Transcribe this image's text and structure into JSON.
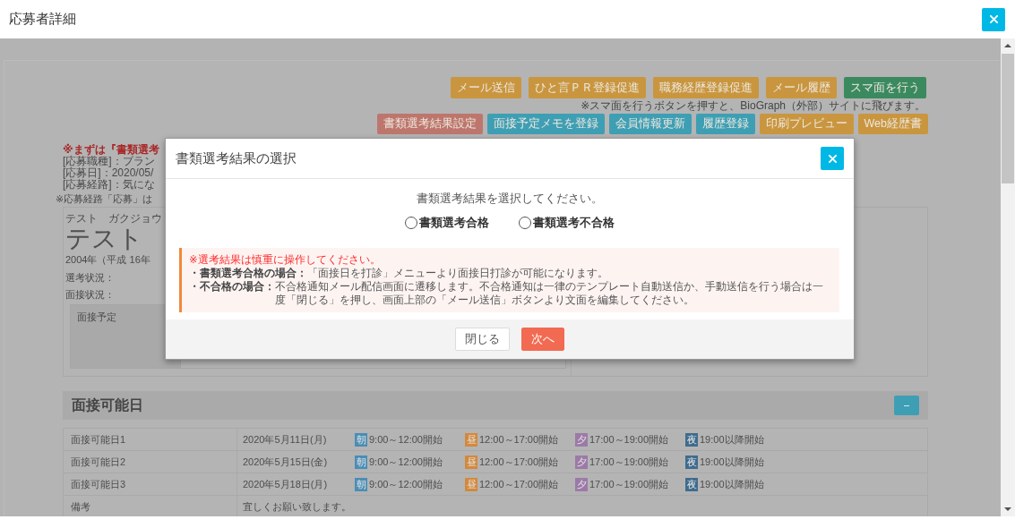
{
  "window": {
    "title": "応募者詳細"
  },
  "actions": {
    "row_1": [
      {
        "label": "メール送信",
        "color": "#c9963f"
      },
      {
        "label": "ひと言ＰＲ登録促進",
        "color": "#c9963f"
      },
      {
        "label": "職務経歴登録促進",
        "color": "#c9963f"
      },
      {
        "label": "メール履歴",
        "color": "#c9963f"
      },
      {
        "label": "スマ面を行う",
        "color": "#3b8a5f"
      }
    ],
    "note": "※スマ面を行うボタンを押すと、BioGraph（外部）サイトに飛びます。",
    "row_2": [
      {
        "label": "書類選考結果設定",
        "color": "#bd766d"
      },
      {
        "label": "面接予定メモを登録",
        "color": "#3e9fb4"
      },
      {
        "label": "会員情報更新",
        "color": "#3e9fb4"
      },
      {
        "label": "履歴登録",
        "color": "#3e9fb4"
      },
      {
        "label": "印刷プレビュー",
        "color": "#c9963f"
      },
      {
        "label": "Web経歴書",
        "color": "#c9963f"
      }
    ]
  },
  "application": {
    "notice": "※まずは『書類選考",
    "lines": [
      "[応募職種]：プラン",
      "[応募日]：2020/05/",
      "[応募経路]：気にな"
    ],
    "route_note": "※応募経路「応募」は"
  },
  "applicant": {
    "kana": "テスト　ガクジョウ",
    "name": "テスト",
    "birth": "2004年（平成 16年",
    "status_labels": [
      "選考状況：",
      "面接状況："
    ],
    "schedule_label": "面接予定"
  },
  "availability": {
    "title": "面接可能日",
    "rows": [
      {
        "label": "面接可能日1",
        "date": "2020年5月11日(月)",
        "slots": [
          {
            "badge": "朝",
            "time": "9:00～12:00開始",
            "color": "#4a8db5"
          },
          {
            "badge": "昼",
            "time": "12:00～17:00開始",
            "color": "#d2893d"
          },
          {
            "badge": "夕",
            "time": "17:00～19:00開始",
            "color": "#9c7aa7"
          },
          {
            "badge": "夜",
            "time": "19:00以降開始",
            "color": "#3f6c8d"
          }
        ]
      },
      {
        "label": "面接可能日2",
        "date": "2020年5月15日(金)",
        "slots": [
          {
            "badge": "朝",
            "time": "9:00～12:00開始",
            "color": "#4a8db5"
          },
          {
            "badge": "昼",
            "time": "12:00～17:00開始",
            "color": "#d2893d"
          },
          {
            "badge": "夕",
            "time": "17:00～19:00開始",
            "color": "#9c7aa7"
          },
          {
            "badge": "夜",
            "time": "19:00以降開始",
            "color": "#3f6c8d"
          }
        ]
      },
      {
        "label": "面接可能日3",
        "date": "2020年5月18日(月)",
        "slots": [
          {
            "badge": "朝",
            "time": "9:00～12:00開始",
            "color": "#4a8db5"
          },
          {
            "badge": "昼",
            "time": "12:00～17:00開始",
            "color": "#d2893d"
          },
          {
            "badge": "夕",
            "time": "17:00～19:00開始",
            "color": "#9c7aa7"
          },
          {
            "badge": "夜",
            "time": "19:00以降開始",
            "color": "#3f6c8d"
          }
        ]
      }
    ],
    "remarks": {
      "label": "備考",
      "text": "宜しくお願い致します。"
    }
  },
  "dialog": {
    "title": "書類選考結果の選択",
    "prompt": "書類選考結果を選択してください。",
    "options": [
      {
        "label": "書類選考合格",
        "selected": false
      },
      {
        "label": "書類選考不合格",
        "selected": false
      }
    ],
    "warning": "※選考結果は慎重に操作してください。",
    "notes": [
      {
        "label": "・書類選考合格の場合：",
        "text": "「面接日を打診」メニューより面接日打診が可能になります。"
      },
      {
        "label": "・不合格の場合：",
        "text": "不合格通知メール配信画面に遷移します。不合格通知は一律のテンプレート自動送信か、手動送信を行う場合は一度「閉じる」を押し、画面上部の「メール送信」ボタンより文面を編集してください。"
      }
    ],
    "buttons": [
      {
        "label": "閉じる",
        "kind": "default"
      },
      {
        "label": "次へ",
        "kind": "primary"
      }
    ]
  }
}
